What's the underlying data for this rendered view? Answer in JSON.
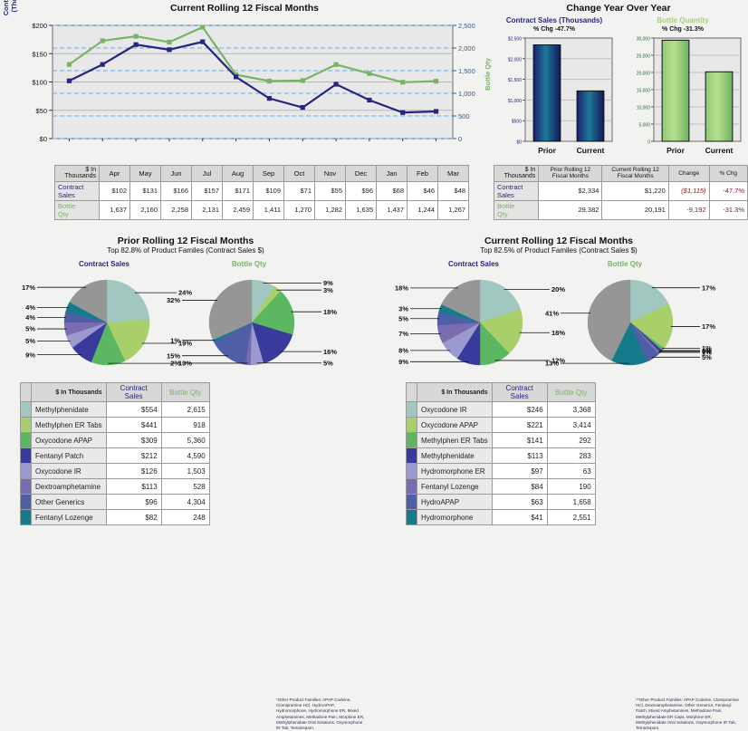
{
  "line_chart": {
    "title": "Current Rolling 12 Fiscal Months",
    "y_left_label": "Contract Sales (Thousands)",
    "y_right_label": "Bottle Qty"
  },
  "yoy": {
    "title": "Change Year Over Year",
    "left": {
      "title": "Contract Sales (Thousands)",
      "pct_change": "% Chg -47.7%"
    },
    "right": {
      "title": "Bottle Quantity",
      "pct_change": "% Chg -31.3%"
    }
  },
  "months_table": {
    "corner": "$ In\nThousands",
    "row1_label": "Contract\nSales",
    "row2_label": "Bottle\nQty"
  },
  "yoy_table": {
    "corner": "$ In\nThousands",
    "headers": [
      "Prior Rolling 12\nFiscal Months",
      "Current Rolling 12\nFiscal Months",
      "Change",
      "% Chg"
    ],
    "rows": [
      {
        "label": "Contract\nSales",
        "prior": "$2,334",
        "current": "$1,220",
        "change": "($1,115)",
        "pct": "-47.7%"
      },
      {
        "label": "Bottle\nQty",
        "prior": "29,382",
        "current": "20,191",
        "change": "-9,192",
        "pct": "-31.3%"
      }
    ]
  },
  "prior": {
    "title": "Prior Rolling 12 Fiscal Months",
    "subtitle": "Top 82.8% of Product Familes (Contract Sales $)",
    "pie_cs_label": "Contract Sales",
    "pie_bq_label": "Bottle Qty",
    "table_corner": "$ In Thousands",
    "col_cs": "Contract Sales",
    "col_bq": "Bottle Qty",
    "footnote": "*Other Product Families: APAP Codeine, Clomipramine HCl, HydroAPAP, Hydromorphone, Hydromorphone ER, Mixed Amphetamines, Methadone Pain, Morphine ER, Methylphenidate Oral Solutions, Oxymorphone IR Tab, Temazepam."
  },
  "current": {
    "title": "Current Rolling 12 Fiscal Months",
    "subtitle": "Top 82.5% of Product Familes (Contract Sales $)",
    "pie_cs_label": "Contract Sales",
    "pie_bq_label": "Bottle Qty",
    "table_corner": "$ In Thousands",
    "col_cs": "Contract Sales",
    "col_bq": "Bottle Qty",
    "footnote": "**Other Product Families: APAP Codeine, Clomipramine HCl, Dextroamphetamine, Other Generics, Fentanyl Patch, Mixed Amphetamines, Methadone Pain, Methylphenidate ER Caps, Morphine ER, Methylphenidate Oral Solutions, Oxymorphone IR Tab, Temazepam."
  },
  "colors": {
    "contract_sales": "#26267f",
    "bottle_qty": "#79b465",
    "negative": "#8b1d28",
    "plot_bg": "#e8e8e8",
    "grid_blue": "#6fa8dc"
  },
  "chart_data": [
    {
      "type": "line",
      "title": "Current Rolling 12 Fiscal Months",
      "categories": [
        "Apr",
        "May",
        "Jun",
        "Jul",
        "Aug",
        "Sep",
        "Oct",
        "Nov",
        "Dec",
        "Jan",
        "Feb",
        "Mar"
      ],
      "series": [
        {
          "name": "Contract Sales",
          "axis": "left",
          "color": "#26267f",
          "values": [
            102,
            131,
            166,
            157,
            171,
            109,
            71,
            55,
            96,
            68,
            46,
            48
          ],
          "display": [
            "$102",
            "$131",
            "$166",
            "$157",
            "$171",
            "$109",
            "$71",
            "$55",
            "$96",
            "$68",
            "$46",
            "$48"
          ]
        },
        {
          "name": "Bottle Qty",
          "axis": "right",
          "color": "#79b465",
          "values": [
            1637,
            2160,
            2258,
            2131,
            2459,
            1411,
            1270,
            1282,
            1635,
            1437,
            1244,
            1267
          ],
          "display": [
            "1,637",
            "2,160",
            "2,258",
            "2,131",
            "2,459",
            "1,411",
            "1,270",
            "1,282",
            "1,635",
            "1,437",
            "1,244",
            "1,267"
          ]
        }
      ],
      "ylabel": "Contract Sales (Thousands)",
      "ylabel_right": "Bottle Qty",
      "ylim": [
        0,
        200
      ],
      "ylim_right": [
        0,
        2500
      ],
      "yticks": [
        "$0",
        "$50",
        "$100",
        "$150",
        "$200"
      ],
      "yticks_right": [
        "0",
        "500",
        "1,000",
        "1,500",
        "2,000",
        "2,500"
      ],
      "grid": true
    },
    {
      "type": "bar",
      "title": "Contract Sales (Thousands)",
      "subtitle": "% Chg -47.7%",
      "categories": [
        "Prior",
        "Current"
      ],
      "values": [
        2334,
        1220
      ],
      "ylim": [
        0,
        2500
      ],
      "yticks": [
        "$0",
        "$500",
        "$1,000",
        "$1,500",
        "$2,000",
        "$2,500"
      ]
    },
    {
      "type": "bar",
      "title": "Bottle Quantity",
      "subtitle": "% Chg -31.3%",
      "categories": [
        "Prior",
        "Current"
      ],
      "values": [
        29382,
        20191
      ],
      "ylim": [
        0,
        30000
      ],
      "yticks": [
        "0",
        "5,000",
        "10,000",
        "15,000",
        "20,000",
        "25,000",
        "30,000"
      ]
    },
    {
      "type": "pie",
      "title": "Prior Rolling 12 Fiscal Months - Contract Sales",
      "labels": [
        "Methylphenidate",
        "Methylphen ER Tabs",
        "Oxycodone APAP",
        "Fentanyl Patch",
        "Oxycodone IR",
        "Dextroamphetamine",
        "Other Generics",
        "Fentanyl Lozenge",
        "Other*"
      ],
      "values": [
        24,
        19,
        13,
        9,
        5,
        5,
        4,
        4,
        17
      ],
      "display_pct": [
        "24%",
        "19%",
        "13%",
        "9%",
        "5%",
        "5%",
        "4%",
        "4%",
        "17%"
      ],
      "colors": [
        "#a0c8c0",
        "#a8cf6a",
        "#5cb762",
        "#3a3a9c",
        "#9a9ad0",
        "#7b6bb0",
        "#4e5fa8",
        "#157a8c",
        "#969696"
      ]
    },
    {
      "type": "pie",
      "title": "Prior Rolling 12 Fiscal Months - Bottle Qty",
      "labels": [
        "Methylphenidate",
        "Methylphen ER Tabs",
        "Oxycodone APAP",
        "Fentanyl Patch",
        "Oxycodone IR",
        "Dextroamphetamine",
        "Other Generics",
        "Fentanyl Lozenge",
        "Other*"
      ],
      "values": [
        9,
        3,
        18,
        16,
        5,
        2,
        15,
        1,
        32
      ],
      "display_pct": [
        "9%",
        "3%",
        "18%",
        "16%",
        "5%",
        "2%",
        "15%",
        "1%",
        "32%"
      ],
      "colors": [
        "#a0c8c0",
        "#a8cf6a",
        "#5cb762",
        "#3a3a9c",
        "#9a9ad0",
        "#7b6bb0",
        "#4e5fa8",
        "#157a8c",
        "#969696"
      ]
    },
    {
      "type": "pie",
      "title": "Current Rolling 12 Fiscal Months - Contract Sales",
      "labels": [
        "Oxycodone IR",
        "Oxycodone APAP",
        "Methylphen ER Tabs",
        "Methylphenidate",
        "Hydromorphone ER",
        "Fentanyl Lozenge",
        "HydroAPAP",
        "Hydromorphone",
        "Other**"
      ],
      "values": [
        20,
        18,
        12,
        9,
        8,
        7,
        5,
        3,
        18
      ],
      "display_pct": [
        "20%",
        "18%",
        "12%",
        "9%",
        "8%",
        "7%",
        "5%",
        "3%",
        "18%"
      ],
      "colors": [
        "#a0c8c0",
        "#a8cf6a",
        "#5cb762",
        "#3a3a9c",
        "#9a9ad0",
        "#7b6bb0",
        "#4e5fa8",
        "#157a8c",
        "#969696"
      ]
    },
    {
      "type": "pie",
      "title": "Current Rolling 12 Fiscal Months - Bottle Qty",
      "labels": [
        "Oxycodone IR",
        "Oxycodone APAP",
        "Methylphen ER Tabs",
        "Methylphenidate",
        "Hydromorphone ER",
        "Fentanyl Lozenge",
        "HydroAPAP",
        "Hydromorphone",
        "Other**"
      ],
      "values": [
        17,
        17,
        1,
        1,
        0,
        1,
        5,
        13,
        41
      ],
      "display_pct": [
        "17%",
        "17%",
        "1%",
        "1%",
        "0%",
        "1%",
        "5%",
        "13%",
        "41%"
      ],
      "colors": [
        "#a0c8c0",
        "#a8cf6a",
        "#5cb762",
        "#3a3a9c",
        "#9a9ad0",
        "#7b6bb0",
        "#4e5fa8",
        "#157a8c",
        "#969696"
      ]
    }
  ],
  "prior_products": [
    {
      "color": "#a0c8c0",
      "name": "Methylphenidate",
      "cs": "$554",
      "bq": "2,615"
    },
    {
      "color": "#a8cf6a",
      "name": "Methylphen ER Tabs",
      "cs": "$441",
      "bq": "918"
    },
    {
      "color": "#5cb762",
      "name": "Oxycodone APAP",
      "cs": "$309",
      "bq": "5,360"
    },
    {
      "color": "#3a3a9c",
      "name": "Fentanyl Patch",
      "cs": "$212",
      "bq": "4,590"
    },
    {
      "color": "#9a9ad0",
      "name": "Oxycodone IR",
      "cs": "$126",
      "bq": "1,503"
    },
    {
      "color": "#7b6bb0",
      "name": "Dextroamphetamine",
      "cs": "$113",
      "bq": "528"
    },
    {
      "color": "#4e5fa8",
      "name": "Other Generics",
      "cs": "$96",
      "bq": "4,304"
    },
    {
      "color": "#157a8c",
      "name": "Fentanyl Lozenge",
      "cs": "$82",
      "bq": "248"
    }
  ],
  "current_products": [
    {
      "color": "#a0c8c0",
      "name": "Oxycodone IR",
      "cs": "$246",
      "bq": "3,368"
    },
    {
      "color": "#a8cf6a",
      "name": "Oxycodone APAP",
      "cs": "$221",
      "bq": "3,414"
    },
    {
      "color": "#5cb762",
      "name": "Methylphen ER Tabs",
      "cs": "$141",
      "bq": "292"
    },
    {
      "color": "#3a3a9c",
      "name": "Methylphenidate",
      "cs": "$113",
      "bq": "283"
    },
    {
      "color": "#9a9ad0",
      "name": "Hydromorphone ER",
      "cs": "$97",
      "bq": "63"
    },
    {
      "color": "#7b6bb0",
      "name": "Fentanyl Lozenge",
      "cs": "$84",
      "bq": "190"
    },
    {
      "color": "#4e5fa8",
      "name": "HydroAPAP",
      "cs": "$63",
      "bq": "1,658"
    },
    {
      "color": "#157a8c",
      "name": "Hydromorphone",
      "cs": "$41",
      "bq": "2,551"
    }
  ]
}
